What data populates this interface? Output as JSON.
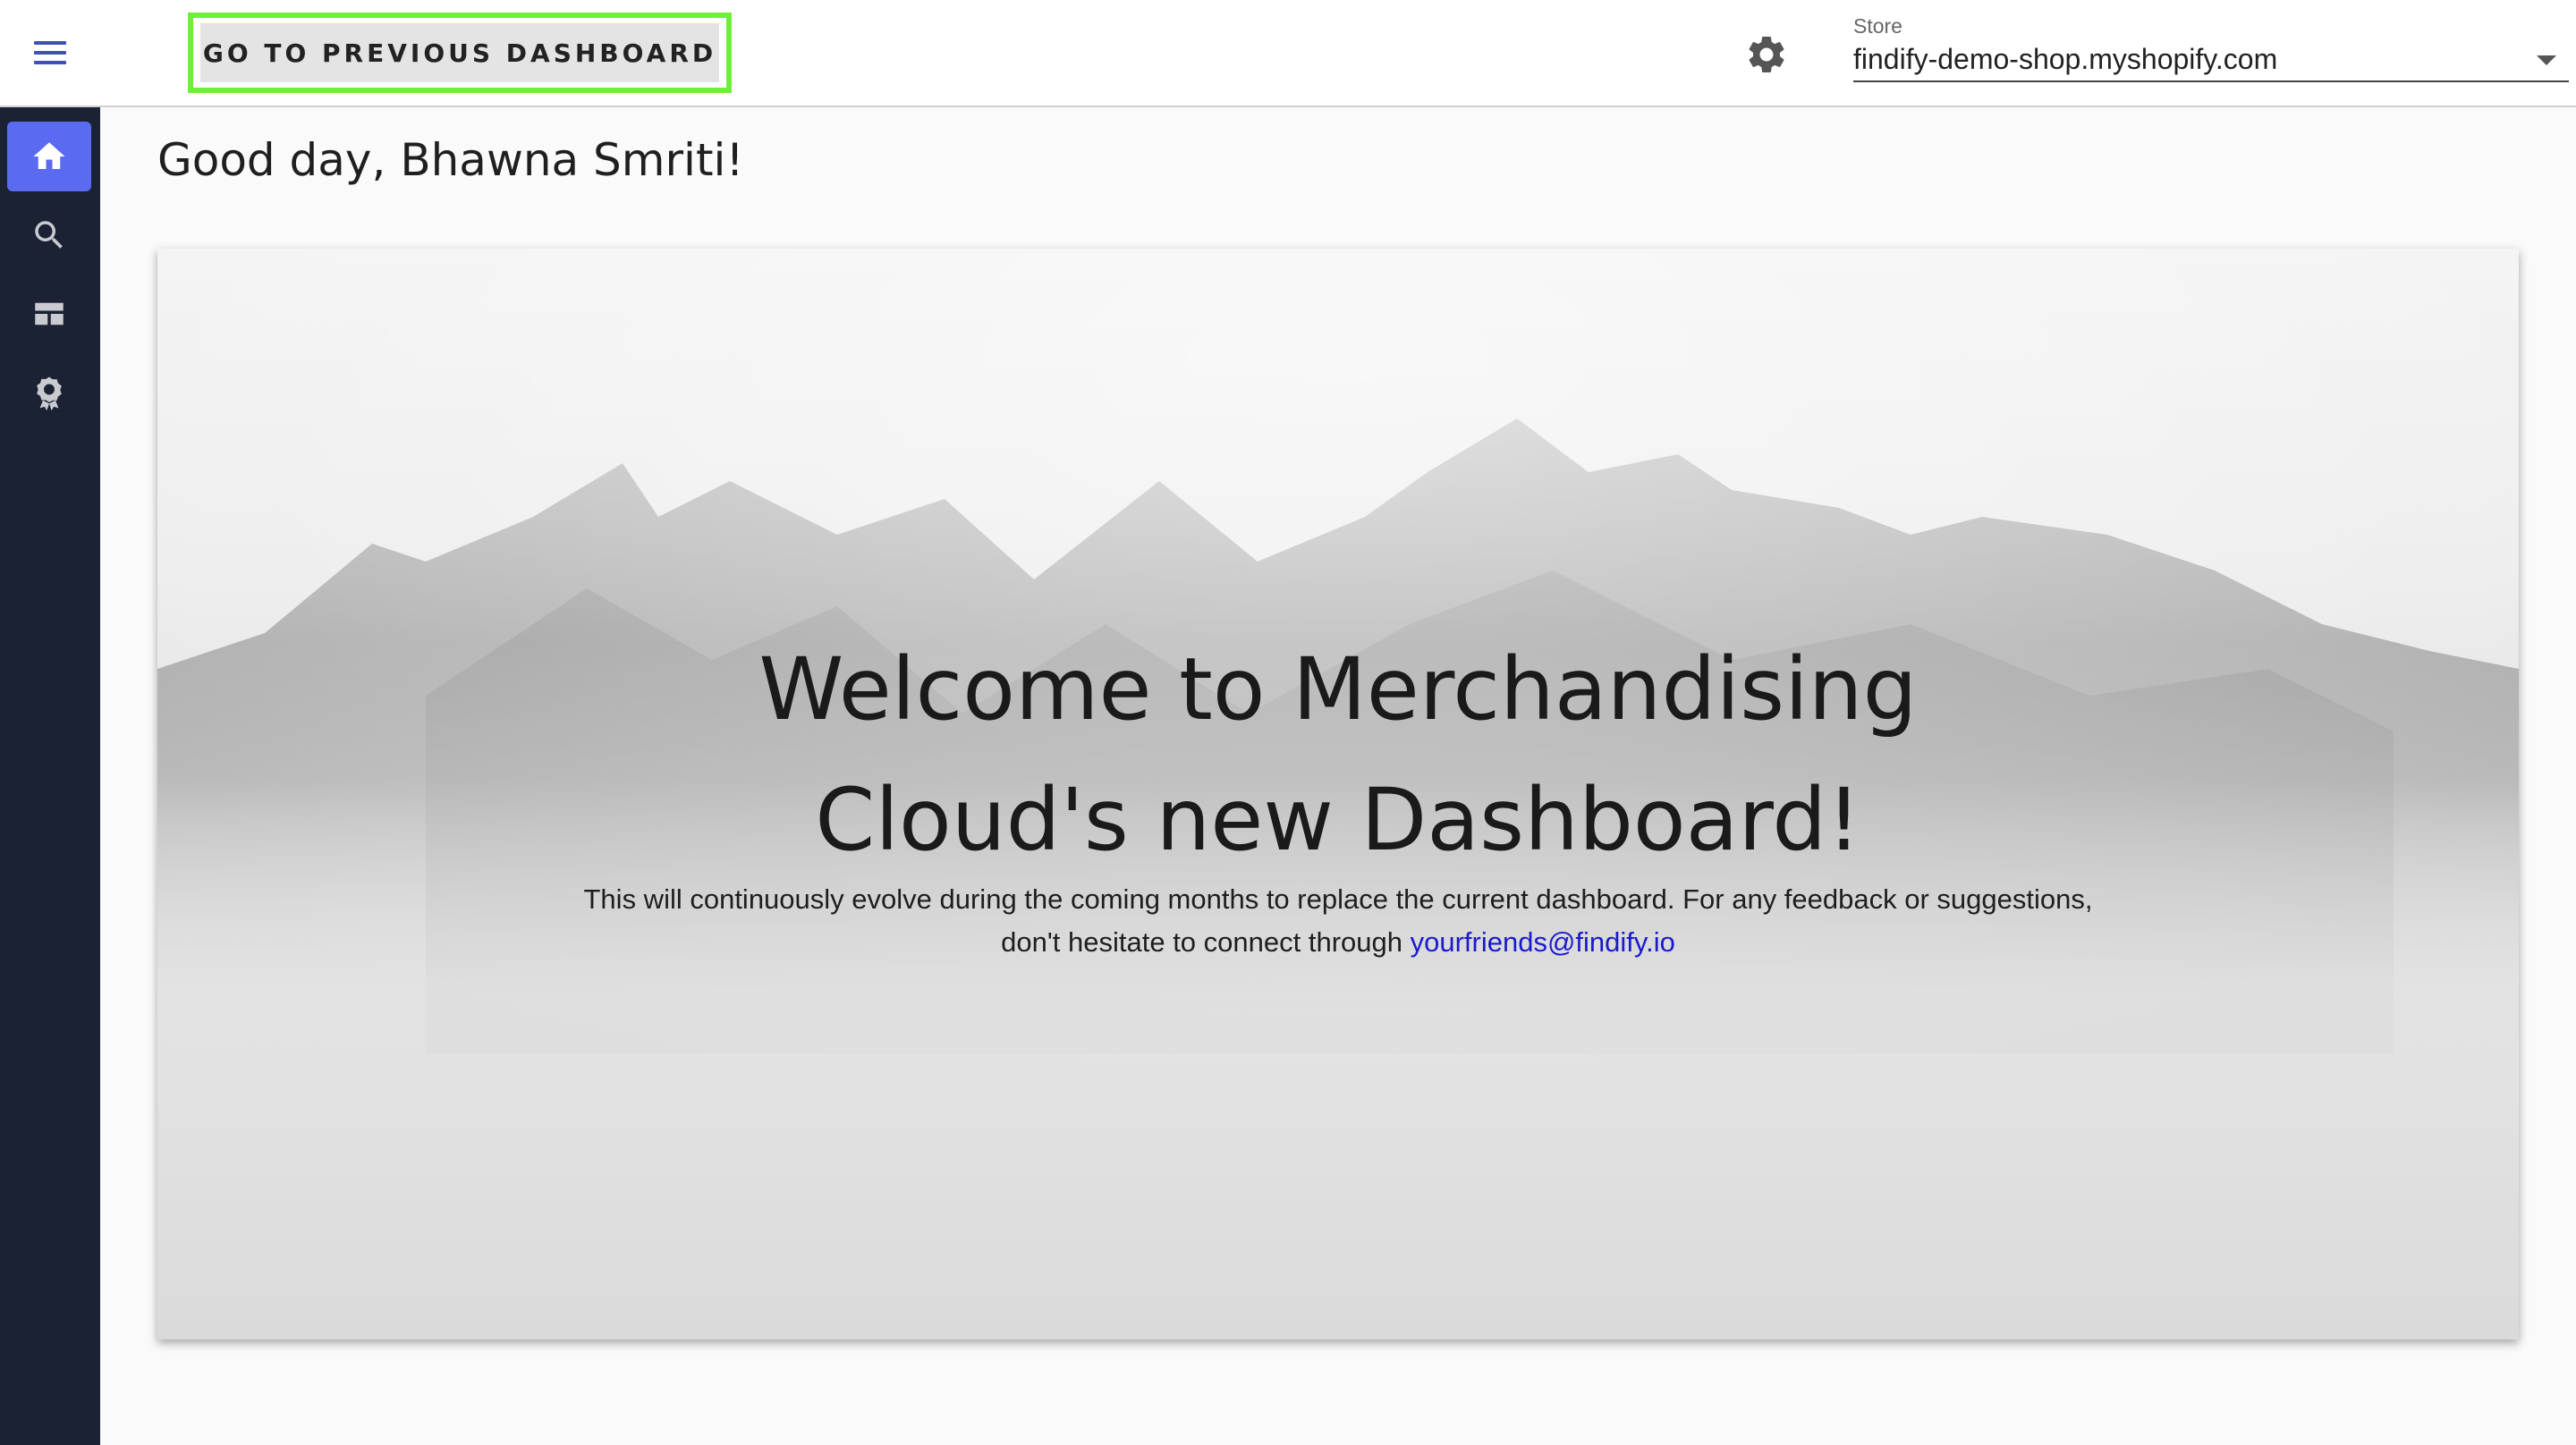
{
  "header": {
    "menu_icon": "hamburger-menu-icon",
    "prev_dashboard_label": "GO TO PREVIOUS DASHBOARD",
    "settings_icon": "gear-icon",
    "store_label": "Store",
    "store_value": "findify-demo-shop.myshopify.com"
  },
  "sidebar": {
    "items": [
      {
        "icon": "home-icon",
        "active": true
      },
      {
        "icon": "search-icon",
        "active": false
      },
      {
        "icon": "table-icon",
        "active": false
      },
      {
        "icon": "award-icon",
        "active": false
      }
    ]
  },
  "main": {
    "greeting": "Good day, Bhawna Smriti!",
    "hero": {
      "title_line1": "Welcome to Merchandising",
      "title_line2": "Cloud's new Dashboard!",
      "body_before_link": "This will continuously evolve during the coming months to replace the current dashboard. For any feedback or suggestions, don't hesitate to connect through ",
      "link_text": "yourfriends@findify.io"
    }
  },
  "colors": {
    "accent": "#3f51b5",
    "active_nav": "#5a6bf2",
    "sidebar_bg": "#1b2233",
    "highlight_border": "#6ef03a",
    "link": "#1a1ad1"
  }
}
